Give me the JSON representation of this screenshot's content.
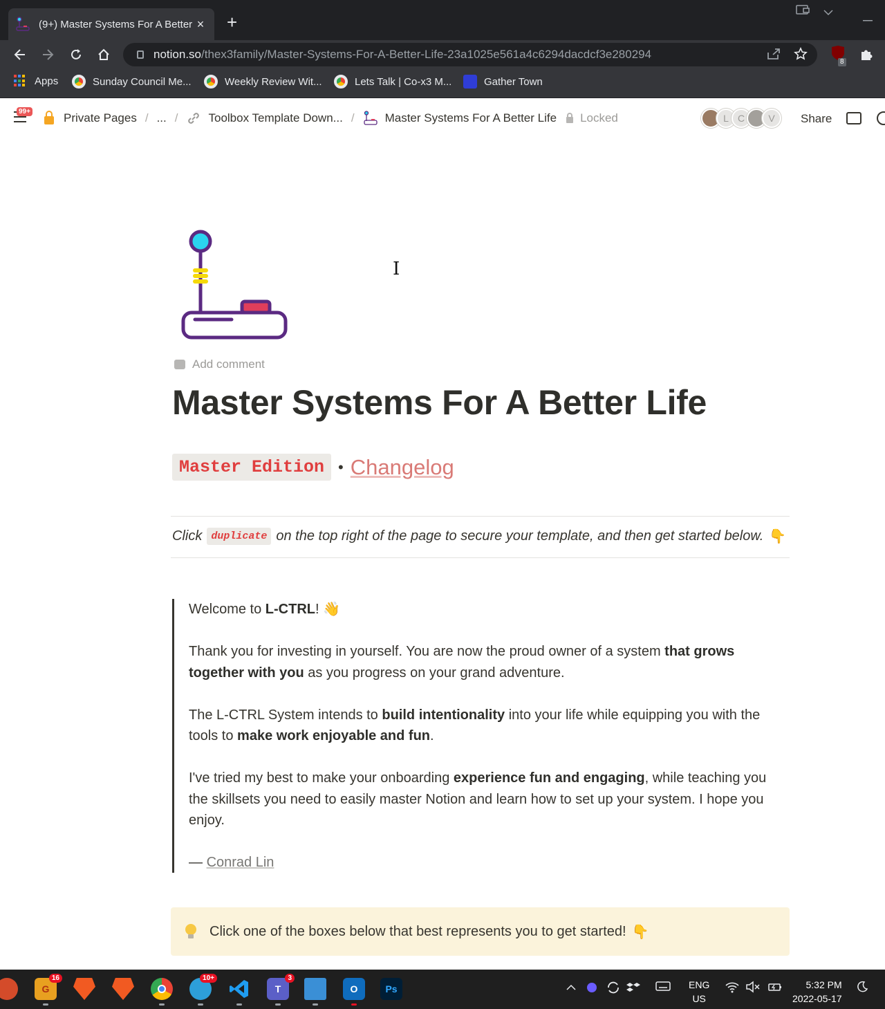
{
  "browser": {
    "tab_title": "(9+) Master Systems For A Better",
    "close_glyph": "×",
    "newtab_glyph": "+",
    "url_host": "notion.so",
    "url_path": "/thex3family/Master-Systems-For-A-Better-Life-23a1025e561a4c6294dacdcf3e280294",
    "ext_badge": "8",
    "bookmarks": [
      {
        "label": "Apps"
      },
      {
        "label": "Sunday Council Me..."
      },
      {
        "label": "Weekly Review Wit..."
      },
      {
        "label": "Lets Talk | Co-x3 M..."
      },
      {
        "label": "Gather Town"
      }
    ]
  },
  "notion": {
    "updates_badge": "99+",
    "breadcrumbs": [
      "Private Pages",
      "...",
      "Toolbox Template Down...",
      "Master Systems For A Better Life"
    ],
    "separator": "/",
    "locked_label": "Locked",
    "avatars": [
      "L",
      "C",
      "V"
    ],
    "share_label": "Share"
  },
  "page": {
    "add_comment": "Add comment",
    "title": "Master Systems For A Better Life",
    "edition_code": "Master Edition",
    "bullet": "•",
    "changelog_link": "Changelog",
    "intro_before": "Click",
    "intro_code": "duplicate",
    "intro_after": "on the top right of the page to secure your template, and then get started below.",
    "intro_emoji": "👇",
    "quote": {
      "welcome_pre": "Welcome to ",
      "welcome_brand": "L-CTRL",
      "welcome_post": "! ",
      "welcome_emoji": "👋",
      "p2_a": "Thank you for investing in yourself. You are now the proud owner of a system ",
      "p2_b": "that grows together with you",
      "p2_c": " as you progress on your grand adventure.",
      "p3_a": "The L-CTRL System intends to ",
      "p3_b": "build intentionality",
      "p3_c": " into your life while equipping you with the tools to ",
      "p3_d": "make work enjoyable and fun",
      "p3_e": ".",
      "p4_a": "I've tried my best to make your onboarding ",
      "p4_b": "experience fun and engaging",
      "p4_c": ", while teaching you the skillsets you need to easily master Notion and learn how to set up your system. I hope you enjoy.",
      "author_dash": "— ",
      "author": "Conrad Lin"
    },
    "callout_text": "Click one of the boxes below that best represents you to get started!",
    "callout_emoji": "👇"
  },
  "taskbar": {
    "badges": {
      "grammarly": "16",
      "app5": "10+",
      "teams": "3"
    },
    "ps_label": "Ps",
    "lang_top": "ENG",
    "lang_bottom": "US",
    "time": "5:32 PM",
    "date": "2022-05-17"
  },
  "colors": {
    "accent_red": "#e03e3e",
    "link_pink": "#d97a76",
    "callout_bg": "#fbf3db"
  }
}
